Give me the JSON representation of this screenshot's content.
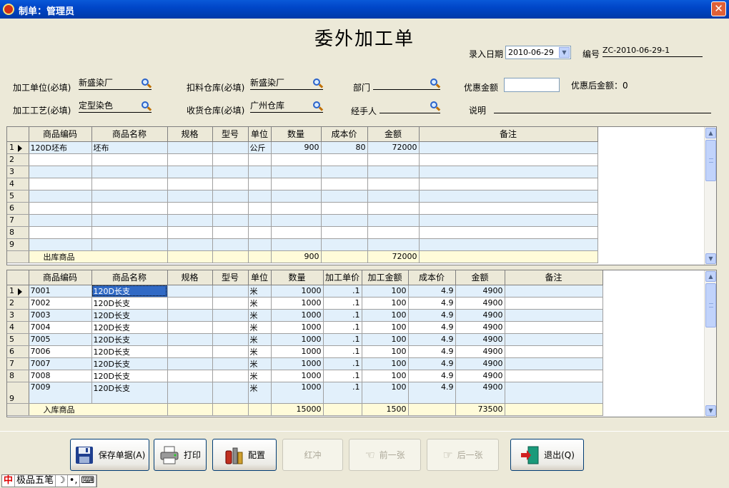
{
  "window": {
    "title": "制单：管理员",
    "close": "✕"
  },
  "doc_title": "委外加工单",
  "header": {
    "date_label": "录入日期",
    "date_value": "2010-06-29",
    "number_label": "编号",
    "number_value": "ZC-2010-06-29-1"
  },
  "fields": {
    "process_unit_label": "加工单位(必填)",
    "process_unit_value": "新盛染厂",
    "deduct_wh_label": "扣料仓库(必填)",
    "deduct_wh_value": "新盛染厂",
    "dept_label": "部门",
    "dept_value": "",
    "discount_label": "优惠金额",
    "discount_value": "",
    "after_discount_label": "优惠后金额：0",
    "craft_label": "加工工艺(必填)",
    "craft_value": "定型染色",
    "receive_wh_label": "收货仓库(必填)",
    "receive_wh_value": "广州仓库",
    "handler_label": "经手人",
    "handler_value": "",
    "note_label": "说明",
    "note_value": ""
  },
  "grid1": {
    "columns": [
      "商品编码",
      "商品名称",
      "规格",
      "型号",
      "单位",
      "数量",
      "成本价",
      "金额",
      "备注"
    ],
    "rows": [
      {
        "no": "1",
        "code": "120D坯布",
        "name": "坯布",
        "spec": "",
        "model": "",
        "unit": "公斤",
        "qty": "900",
        "cost": "80",
        "amount": "72000",
        "remark": ""
      },
      {
        "no": "2"
      },
      {
        "no": "3"
      },
      {
        "no": "4"
      },
      {
        "no": "5"
      },
      {
        "no": "6"
      },
      {
        "no": "7"
      },
      {
        "no": "8"
      },
      {
        "no": "9"
      }
    ],
    "footer": {
      "label": "出库商品",
      "qty": "900",
      "amount": "72000"
    }
  },
  "grid2": {
    "columns": [
      "商品编码",
      "商品名称",
      "规格",
      "型号",
      "单位",
      "数量",
      "加工单价",
      "加工金额",
      "成本价",
      "金额",
      "备注"
    ],
    "rows": [
      {
        "no": "1",
        "code": "7001",
        "name": "120D长支",
        "unit": "米",
        "qty": "1000",
        "price": ".1",
        "pamount": "100",
        "cost": "4.9",
        "amount": "4900"
      },
      {
        "no": "2",
        "code": "7002",
        "name": "120D长支",
        "unit": "米",
        "qty": "1000",
        "price": ".1",
        "pamount": "100",
        "cost": "4.9",
        "amount": "4900"
      },
      {
        "no": "3",
        "code": "7003",
        "name": "120D长支",
        "unit": "米",
        "qty": "1000",
        "price": ".1",
        "pamount": "100",
        "cost": "4.9",
        "amount": "4900"
      },
      {
        "no": "4",
        "code": "7004",
        "name": "120D长支",
        "unit": "米",
        "qty": "1000",
        "price": ".1",
        "pamount": "100",
        "cost": "4.9",
        "amount": "4900"
      },
      {
        "no": "5",
        "code": "7005",
        "name": "120D长支",
        "unit": "米",
        "qty": "1000",
        "price": ".1",
        "pamount": "100",
        "cost": "4.9",
        "amount": "4900"
      },
      {
        "no": "6",
        "code": "7006",
        "name": "120D长支",
        "unit": "米",
        "qty": "1000",
        "price": ".1",
        "pamount": "100",
        "cost": "4.9",
        "amount": "4900"
      },
      {
        "no": "7",
        "code": "7007",
        "name": "120D长支",
        "unit": "米",
        "qty": "1000",
        "price": ".1",
        "pamount": "100",
        "cost": "4.9",
        "amount": "4900"
      },
      {
        "no": "8",
        "code": "7008",
        "name": "120D长支",
        "unit": "米",
        "qty": "1000",
        "price": ".1",
        "pamount": "100",
        "cost": "4.9",
        "amount": "4900"
      },
      {
        "no": "9",
        "code": "7009",
        "name": "120D长支",
        "unit": "米",
        "qty": "1000",
        "price": ".1",
        "pamount": "100",
        "cost": "4.9",
        "amount": "4900"
      }
    ],
    "footer": {
      "label": "入库商品",
      "qty": "15000",
      "pamount": "1500",
      "amount": "73500"
    }
  },
  "buttons": {
    "save": "保存单据(A)",
    "print": "打印",
    "config": "配置",
    "reverse": "红冲",
    "prev": "前一张",
    "next": "后一张",
    "exit": "退出(Q)"
  },
  "ime": {
    "logo": "中",
    "name": "极品五笔",
    "moon": "☽",
    "punct": "•,",
    "keyboard": "⌨"
  }
}
